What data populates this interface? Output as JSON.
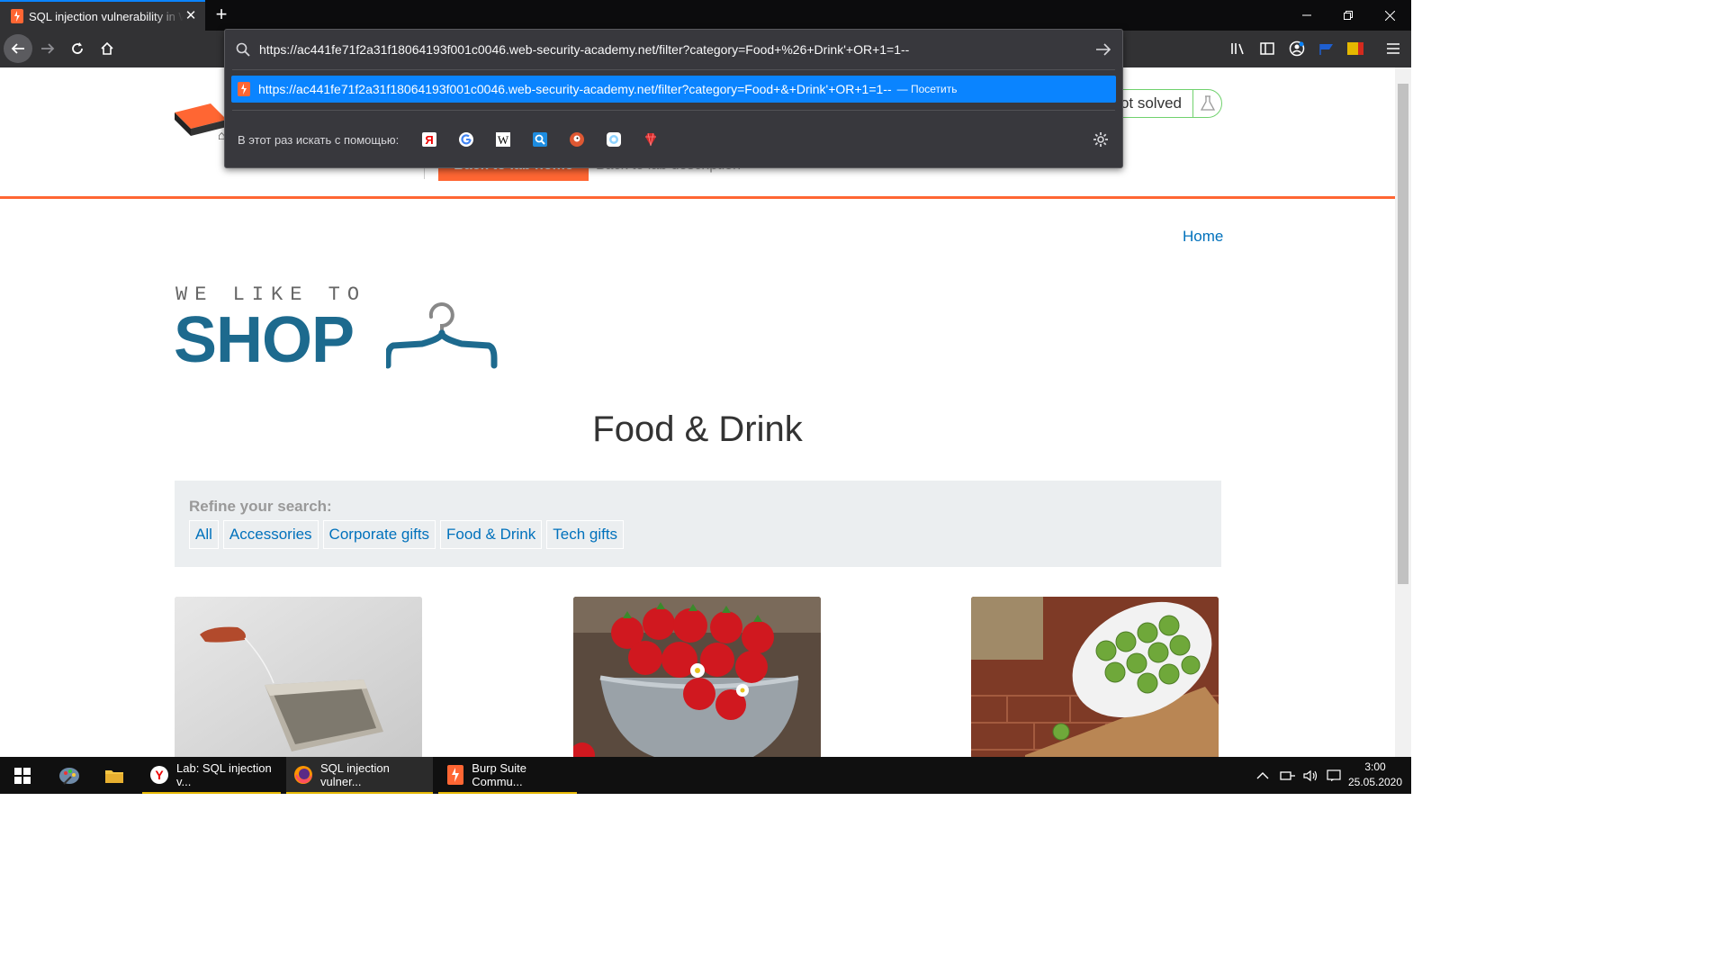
{
  "browser": {
    "tab_title": "SQL injection vulnerability in W",
    "address_value": "https://ac441fe71f2a31f18064193f001c0046.web-security-academy.net/filter?category=Food+%26+Drink'+OR+1=1--",
    "suggestion_url": "https://ac441fe71f2a31f18064193f001c0046.web-security-academy.net/filter?category=Food+&+Drink'+OR+1=1--",
    "suggestion_action": "— Посетить",
    "search_with_label": "В этот раз искать с помощью:",
    "engines": [
      "yandex",
      "google",
      "wikipedia",
      "ozon",
      "duckduckgo",
      "mail",
      "ruby"
    ]
  },
  "lab": {
    "status_text": "ot solved",
    "back_home_label": "Back to lab home",
    "back_desc_label": "Back to lab description »"
  },
  "site": {
    "nav_home": "Home",
    "logo_tagline": "WE LIKE TO",
    "logo_name": "SHOP",
    "heading": "Food & Drink",
    "refine_label": "Refine your search:",
    "filters": [
      "All",
      "Accessories",
      "Corporate gifts",
      "Food & Drink",
      "Tech gifts"
    ]
  },
  "taskbar": {
    "items": [
      {
        "label": "Lab: SQL injection v..."
      },
      {
        "label": "SQL injection vulner..."
      },
      {
        "label": "Burp Suite Commu..."
      }
    ],
    "time": "3:00",
    "date": "25.05.2020"
  },
  "colors": {
    "accent": "#ff6633",
    "link": "#0071bc",
    "logo": "#1d6a8e",
    "browser_highlight": "#0a84ff"
  }
}
